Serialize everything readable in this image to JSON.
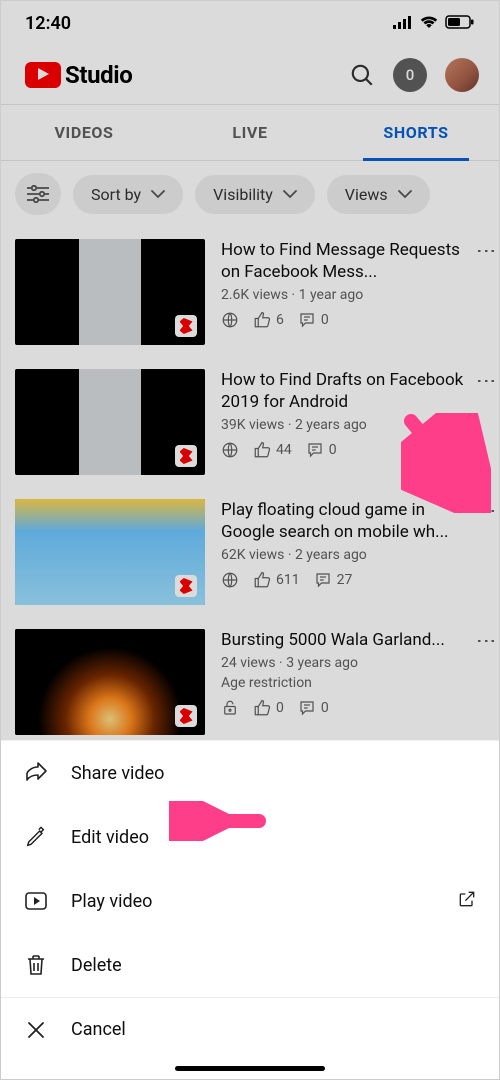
{
  "status": {
    "time": "12:40"
  },
  "header": {
    "app_name": "Studio",
    "notif_count": "0"
  },
  "tabs": {
    "videos": "VIDEOS",
    "live": "LIVE",
    "shorts": "SHORTS"
  },
  "filters": {
    "sort": "Sort by",
    "visibility": "Visibility",
    "views": "Views"
  },
  "videos": [
    {
      "title": "How to Find Message Requests on Facebook Mess...",
      "views": "2.6K views",
      "age": "1 year ago",
      "likes": "6",
      "comments": "0"
    },
    {
      "title": "How to Find Drafts on Facebook 2019 for Android",
      "views": "39K views",
      "age": "2 years ago",
      "likes": "44",
      "comments": "0"
    },
    {
      "title": "Play floating cloud game in Google search on mobile wh...",
      "views": "62K views",
      "age": "2 years ago",
      "likes": "611",
      "comments": "27"
    },
    {
      "title": "Bursting 5000 Wala Garland...",
      "views": "24 views",
      "age": "3 years ago",
      "restriction": "Age restriction",
      "likes": "0",
      "comments": "0"
    }
  ],
  "sheet": {
    "share": "Share video",
    "edit": "Edit video",
    "play": "Play video",
    "delete": "Delete",
    "cancel": "Cancel"
  }
}
